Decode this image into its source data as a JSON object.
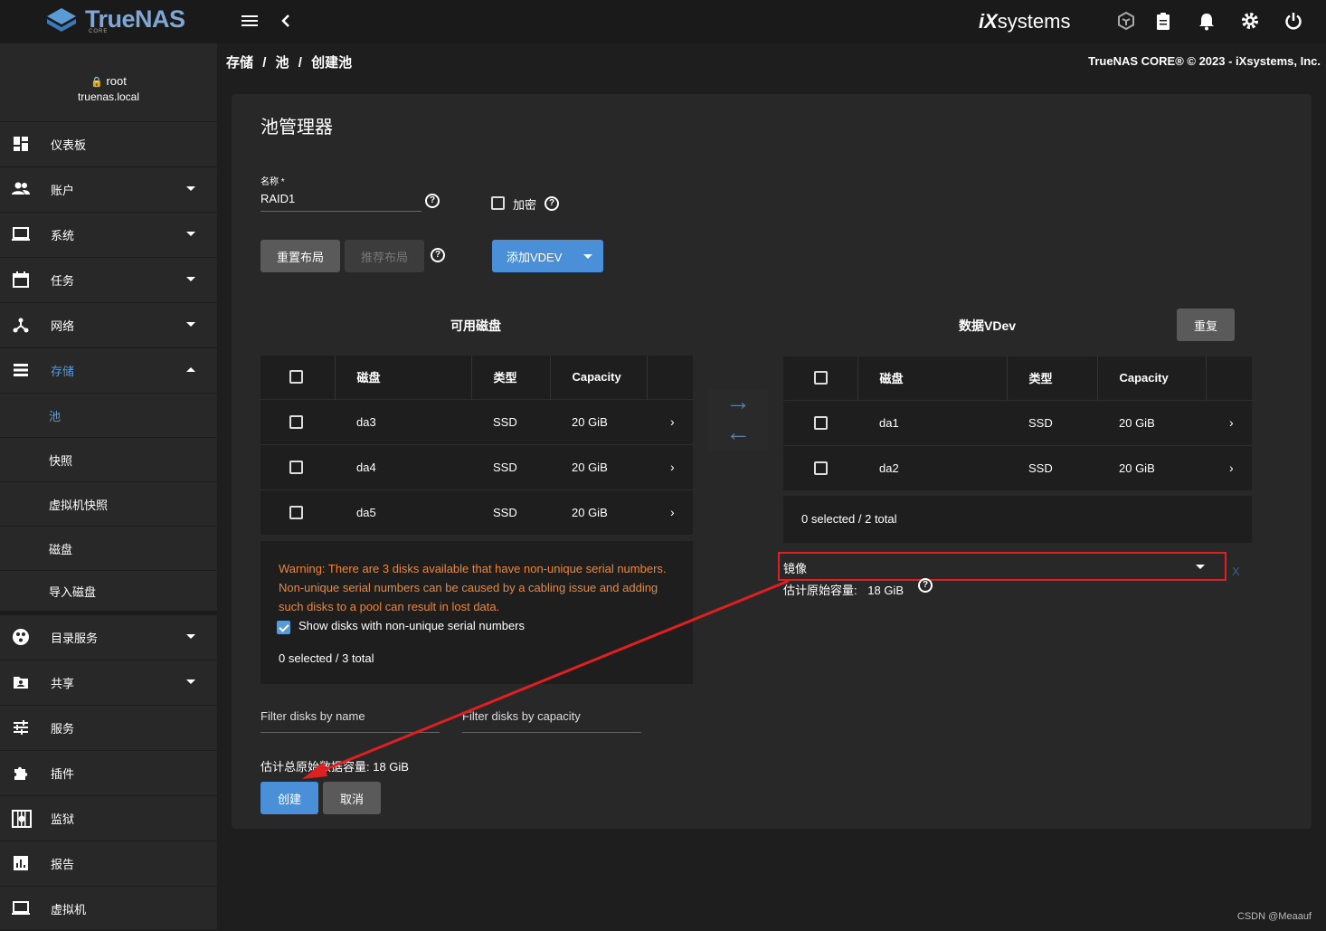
{
  "app": {
    "logo": "TrueNAS",
    "logo_sub": "CORE",
    "vendor": "iXsystems"
  },
  "topbar": {
    "menu_icon": "menu-icon",
    "back_icon": "chevron-left-icon",
    "icons": [
      "truecommand-icon",
      "clipboard-icon",
      "bell-icon",
      "gear-icon",
      "power-icon"
    ]
  },
  "user": {
    "name": "root",
    "host": "truenas.local"
  },
  "sidebar": {
    "items": [
      {
        "label": "仪表板",
        "icon": "dashboard-icon"
      },
      {
        "label": "账户",
        "icon": "accounts-icon"
      },
      {
        "label": "系统",
        "icon": "laptop-icon"
      },
      {
        "label": "任务",
        "icon": "calendar-icon"
      },
      {
        "label": "网络",
        "icon": "network-icon"
      },
      {
        "label": "存储",
        "icon": "storage-icon"
      }
    ],
    "storage_sub": [
      "池",
      "快照",
      "虚拟机快照",
      "磁盘",
      "导入磁盘"
    ],
    "items2": [
      {
        "label": "目录服务",
        "icon": "directory-icon"
      },
      {
        "label": "共享",
        "icon": "share-icon"
      },
      {
        "label": "服务",
        "icon": "services-icon"
      },
      {
        "label": "插件",
        "icon": "puzzle-icon"
      },
      {
        "label": "监狱",
        "icon": "jail-icon"
      },
      {
        "label": "报告",
        "icon": "chart-icon"
      },
      {
        "label": "虚拟机",
        "icon": "monitor-icon"
      }
    ]
  },
  "breadcrumb": {
    "a": "存储",
    "b": "池",
    "c": "创建池",
    "sep": "/"
  },
  "copyright": "TrueNAS CORE® © 2023 - iXsystems, Inc.",
  "pool": {
    "title": "池管理器",
    "name_label": "名称 *",
    "name_value": "RAID1",
    "encrypt_label": "加密",
    "reset_layout": "重置布局",
    "suggest_layout": "推荐布局",
    "add_vdev": "添加VDEV",
    "available_title": "可用磁盘",
    "vdev_title": "数据VDev",
    "repeat": "重复",
    "col_disk": "磁盘",
    "col_type": "类型",
    "col_capacity": "Capacity",
    "available_disks": [
      {
        "name": "da3",
        "type": "SSD",
        "capacity": "20 GiB"
      },
      {
        "name": "da4",
        "type": "SSD",
        "capacity": "20 GiB"
      },
      {
        "name": "da5",
        "type": "SSD",
        "capacity": "20 GiB"
      }
    ],
    "vdev_disks": [
      {
        "name": "da1",
        "type": "SSD",
        "capacity": "20 GiB"
      },
      {
        "name": "da2",
        "type": "SSD",
        "capacity": "20 GiB"
      }
    ],
    "warning": "Warning: There are 3 disks available that have non-unique serial numbers. Non-unique serial numbers can be caused by a cabling issue and adding such disks to a pool can result in lost data.",
    "show_nonunique": "Show disks with non-unique serial numbers",
    "available_count": "0 selected / 3 total",
    "vdev_count": "0 selected / 2 total",
    "vdev_type": "镜像",
    "vdev_remove": "X",
    "est_raw_label": "估计原始容量:",
    "est_raw_value": "18 GiB",
    "filter_name": "Filter disks by name",
    "filter_capacity": "Filter disks by capacity",
    "est_total": "估计总原始数据容量: 18 GiB",
    "create": "创建",
    "cancel": "取消"
  },
  "watermark": "CSDN @Meaauf",
  "colors": {
    "accent": "#4a90d9",
    "warning": "#e8883b",
    "annotation": "#e02020"
  }
}
